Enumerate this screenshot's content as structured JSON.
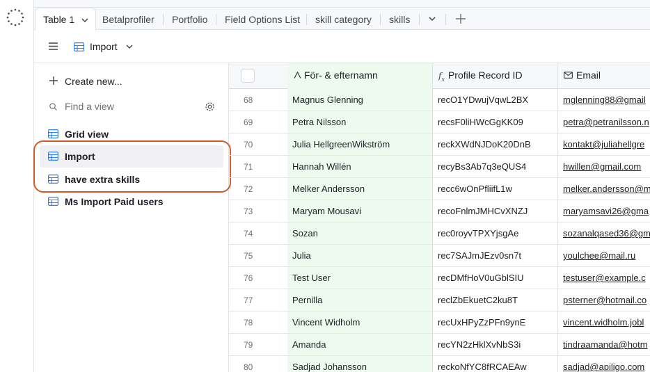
{
  "tabs": [
    {
      "label": "Table 1"
    },
    {
      "label": "Betalprofiler"
    },
    {
      "label": "Portfolio"
    },
    {
      "label": "Field Options List"
    },
    {
      "label": "skill category"
    },
    {
      "label": "skills"
    }
  ],
  "toolbar": {
    "view_name": "Import"
  },
  "sidebar": {
    "create_label": "Create new...",
    "search_placeholder": "Find a view",
    "views": [
      {
        "label": "Grid view"
      },
      {
        "label": "Import"
      },
      {
        "label": "have extra skills"
      },
      {
        "label": "Ms Import Paid users"
      }
    ]
  },
  "grid": {
    "columns": {
      "name": "För- & efternamn",
      "id": "Profile Record ID",
      "email": "Email"
    },
    "rows": [
      {
        "num": "68",
        "name": "Magnus Glenning",
        "id": "recO1YDwujVqwL2BX",
        "email": "mglenning88@gmail"
      },
      {
        "num": "69",
        "name": "Petra Nilsson",
        "id": "recsF0liHWcGgKK09",
        "email": "petra@petranilsson.n"
      },
      {
        "num": "70",
        "name": "Julia HellgreenWikström",
        "id": "reckXWdNJDoK20DnB",
        "email": "kontakt@juliahellgre"
      },
      {
        "num": "71",
        "name": "Hannah Willén",
        "id": "recyBs3Ab7q3eQUS4",
        "email": "hwillen@gmail.com"
      },
      {
        "num": "72",
        "name": "Melker Andersson",
        "id": "recc6wOnPfliifL1w",
        "email": "melker.andersson@m"
      },
      {
        "num": "73",
        "name": "Maryam Mousavi",
        "id": "recoFnlmJMHCvXNZJ",
        "email": "maryamsavi26@gma"
      },
      {
        "num": "74",
        "name": "Sozan",
        "id": "rec0royvTPXYjsgAe",
        "email": "sozanalqased36@gm"
      },
      {
        "num": "75",
        "name": "Julia",
        "id": "rec7SAJmJEzv0sn7t",
        "email": "youlchee@mail.ru"
      },
      {
        "num": "76",
        "name": "Test User",
        "id": "recDMfHoV0uGblSIU",
        "email": "testuser@example.c"
      },
      {
        "num": "77",
        "name": "Pernilla",
        "id": "reclZbEkuetC2ku8T",
        "email": "psterner@hotmail.co"
      },
      {
        "num": "78",
        "name": "Vincent Widholm",
        "id": "recUxHPyZzPFn9ynE",
        "email": "vincent.widholm.jobl"
      },
      {
        "num": "79",
        "name": "Amanda",
        "id": "recYN2zHklXvNbS3i",
        "email": "tindraamanda@hotm"
      },
      {
        "num": "80",
        "name": "Sadjad Johansson",
        "id": "reckoNfYC8fRCAEAw",
        "email": "sadjad@apiligo.com"
      }
    ]
  }
}
